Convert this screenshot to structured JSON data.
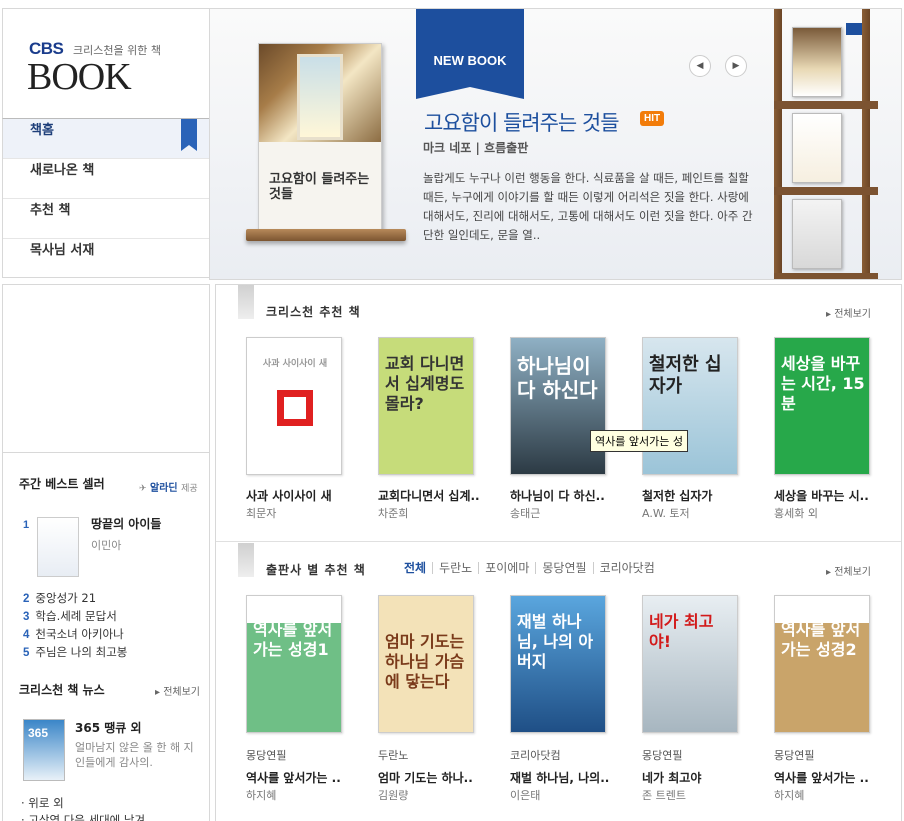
{
  "logo": {
    "cbs": "CBS",
    "tagline": "크리스천을 위한 책",
    "book": "BOOK"
  },
  "nav": {
    "items": [
      "책홈",
      "새로나온 책",
      "추천 책",
      "목사님 서재"
    ]
  },
  "feature": {
    "tag": "NEW BOOK",
    "title": "고요함이 들려주는 것들",
    "badge": "HIT",
    "author": "마크 네포 | 흐름출판",
    "description": "놀랍게도 누구나 이런 행동을 한다. 식료품을 살 때든, 페인트를 칠할 때든, 누구에게 이야기를 할 때든 이렇게 어리석은 짓을 한다. 사랑에 대해서도, 진리에 대해서도, 고통에 대해서도 이런 짓을 한다. 아주 간단한 일인데도, 문을 열..",
    "cover_title": "고요함이 들려주는 것들",
    "prev_icon": "◀",
    "next_icon": "▶"
  },
  "bestseller": {
    "heading": "주간 베스트 셀러",
    "provider": "알라딘",
    "provider_suffix": "제공",
    "top": {
      "rank": "1",
      "title": "땅끝의 아이들",
      "author": "이민아"
    },
    "list": [
      {
        "rank": "2",
        "title": "중앙성가 21"
      },
      {
        "rank": "3",
        "title": "학습.세례 문답서"
      },
      {
        "rank": "4",
        "title": "천국소녀 아키아나"
      },
      {
        "rank": "5",
        "title": "주님은 나의 최고봉"
      }
    ]
  },
  "news": {
    "heading": "크리스천 책 뉴스",
    "more": "▸ 전체보기",
    "thumb_text": "365",
    "title": "365 땡큐 외",
    "desc": "얼마남지 않은 올 한 해 지인들에게 감사의.",
    "list": [
      "· 위로 외",
      "· 고상역 다음 세대에 남겨"
    ]
  },
  "section1": {
    "title": "크리스천 추천 책",
    "more": "▸ 전체보기",
    "books": [
      {
        "title": "사과 사이사이 새",
        "author": "최문자",
        "cover": "사과 사이사이 새",
        "bg": "#ffffff",
        "fg": "#999999"
      },
      {
        "title": "교회다니면서 십계..",
        "author": "차준희",
        "cover": "교회 다니면서 십계명도 몰라?",
        "bg": "#c6dc7a",
        "fg": "#333333"
      },
      {
        "title": "하나님이 다 하신..",
        "author": "송태근",
        "cover": "하나님이 다 하신다",
        "bg": "#2c3a44",
        "fg": "#ffffff"
      },
      {
        "title": "철저한 십자가",
        "author": "A.W. 토저",
        "cover": "철저한 십자가",
        "bg": "#9bc4d8",
        "fg": "#222222"
      },
      {
        "title": "세상을 바꾸는 시..",
        "author": "홍세화 외",
        "cover": "세상을 바꾸는 시간, 15분",
        "bg": "#27a84a",
        "fg": "#ffffff"
      }
    ]
  },
  "section2": {
    "title": "출판사 별 추천 책",
    "more": "▸ 전체보기",
    "tabs": [
      "전체",
      "두란노",
      "포이에마",
      "몽당연필",
      "코리아닷컴"
    ],
    "books": [
      {
        "publisher": "몽당연필",
        "title": "역사를 앞서가는 ..",
        "author": "하지혜",
        "cover": "역사를 앞서가는 성경1",
        "bg": "#6fbf86",
        "fg": "#ffffff"
      },
      {
        "publisher": "두란노",
        "title": "엄마 기도는 하나..",
        "author": "김원량",
        "cover": "엄마 기도는 하나님 가슴에 닿는다",
        "bg": "#f3e2b8",
        "fg": "#7a3a1a"
      },
      {
        "publisher": "코리아닷컴",
        "title": "재벌 하나님, 나의..",
        "author": "이은태",
        "cover": "재벌 하나님, 나의 아버지",
        "bg": "#3a86c6",
        "fg": "#ffffff"
      },
      {
        "publisher": "몽당연필",
        "title": "네가 최고야",
        "author": "존 트렌트",
        "cover": "네가 최고야!",
        "bg": "#a7b6c0",
        "fg": "#d21a1a"
      },
      {
        "publisher": "몽당연필",
        "title": "역사를 앞서가는 ..",
        "author": "하지혜",
        "cover": "역사를 앞서가는 성경2",
        "bg": "#c9a46a",
        "fg": "#ffffff"
      }
    ]
  },
  "tooltip": "역사를 앞서가는 성"
}
